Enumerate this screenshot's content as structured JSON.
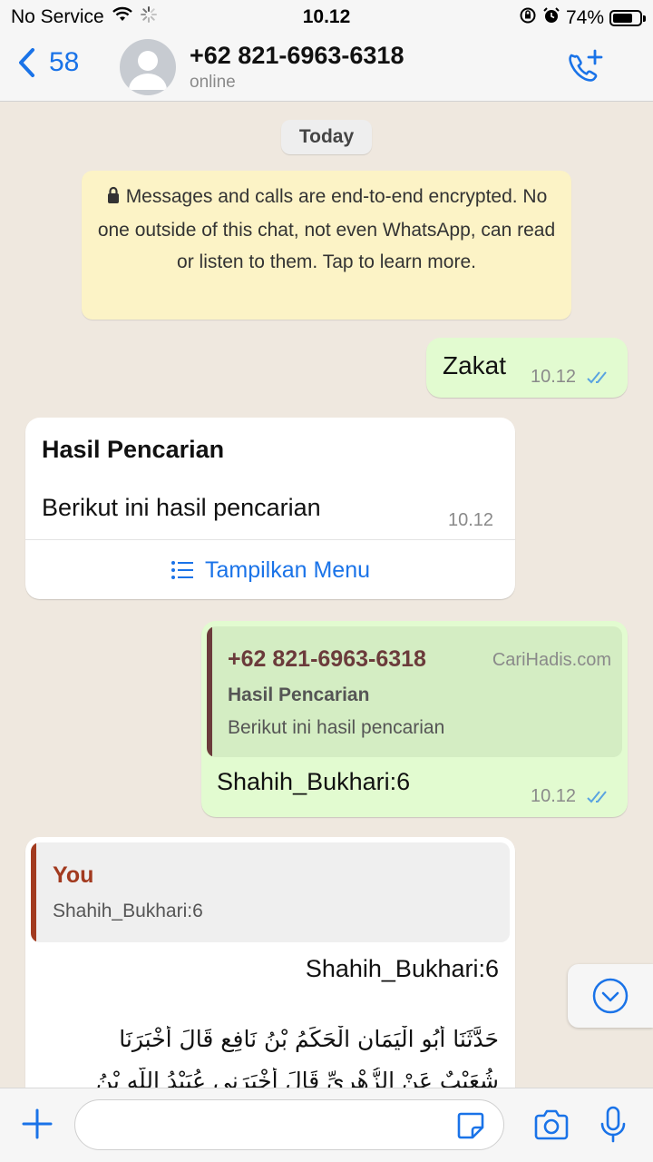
{
  "status_bar": {
    "carrier": "No Service",
    "time": "10.12",
    "battery": "74%",
    "battery_level": 0.74
  },
  "header": {
    "back_count": "58",
    "contact_name": "+62 821-6963-6318",
    "contact_status": "online"
  },
  "chat": {
    "date_label": "Today",
    "encryption_notice": "Messages and calls are end-to-end encrypted. No one outside of this chat, not even WhatsApp, can read or listen to them. Tap to learn more.",
    "messages": [
      {
        "text": "Zakat",
        "time": "10.12"
      },
      {
        "title": "Hasil Pencarian",
        "body": "Berikut ini hasil pencarian",
        "time": "10.12",
        "button_label": "Tampilkan Menu"
      },
      {
        "quote_author": "+62 821-6963-6318",
        "quote_source": "CariHadis.com",
        "quote_title": "Hasil Pencarian",
        "quote_body": "Berikut ini hasil pencarian",
        "text": "Shahih_Bukhari:6",
        "time": "10.12"
      },
      {
        "quote_author": "You",
        "quote_text": "Shahih_Bukhari:6",
        "text": "Shahih_Bukhari:6",
        "arabic_line1": "حَدَّثَنَا أَبُو الْيَمَانِ الْحَكَمُ بْنُ نَافِعٍ قَالَ أَخْبَرَنَا",
        "arabic_line2": "شُعَيْبٌ عَنْ الزُّهْرِيِّ قَالَ أَخْبَرَنِي عُبَيْدُ اللَّهِ بْنُ"
      }
    ]
  },
  "input": {
    "placeholder": "",
    "value": ""
  },
  "colors": {
    "accent": "#1a73e8",
    "outgoing_bubble": "#e2fbd0",
    "incoming_bubble": "#ffffff",
    "encryption_bg": "#fcf3c6",
    "quote_author_other": "#6b3b3b",
    "quote_author_you": "#a23a1f"
  }
}
